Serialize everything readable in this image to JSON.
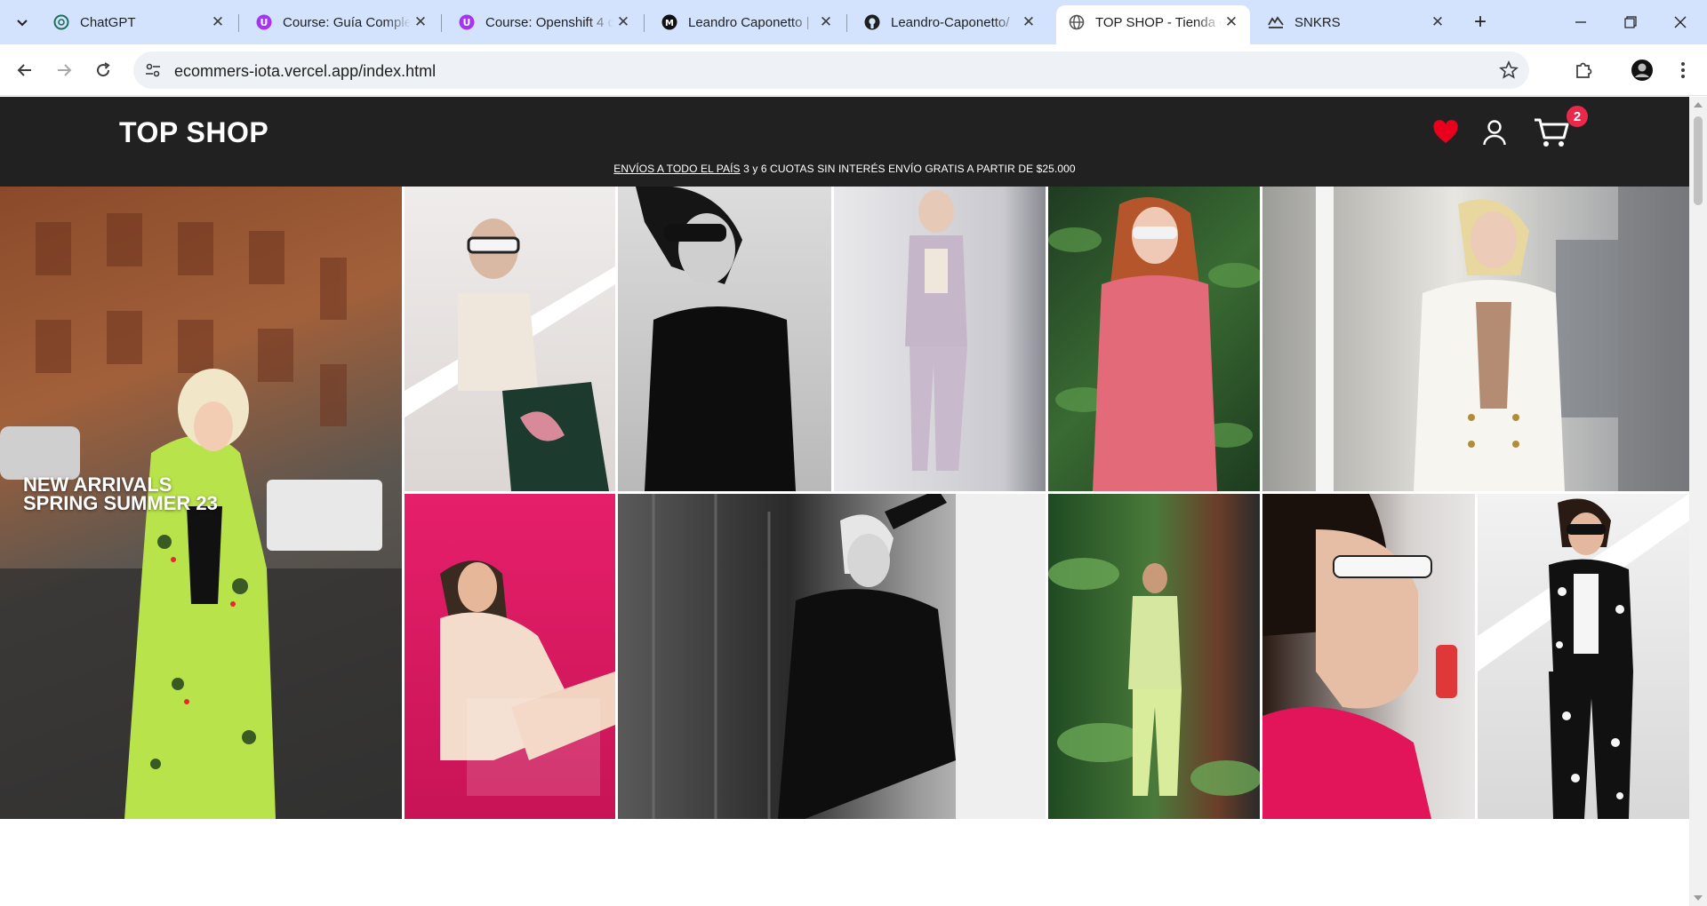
{
  "browser": {
    "tabs": [
      {
        "title": "ChatGPT",
        "icon": "chatgpt-icon"
      },
      {
        "title": "Course: Guía Comple",
        "icon": "course-icon"
      },
      {
        "title": "Course: Openshift 4 c",
        "icon": "course-icon"
      },
      {
        "title": "Leandro Caponetto |",
        "icon": "profile-icon"
      },
      {
        "title": "Leandro-Caponetto/",
        "icon": "github-icon"
      },
      {
        "title": "TOP SHOP - Tienda c",
        "icon": "globe-icon",
        "active": true
      },
      {
        "title": "SNKRS",
        "icon": "snkrs-icon"
      }
    ],
    "url": "ecommers-iota.vercel.app/index.html"
  },
  "site": {
    "logo": "TOP SHOP",
    "cart_count": "2",
    "promo_link": "ENVÍOS A TODO EL PAÍS",
    "promo_text": " 3 y 6 CUOTAS SIN INTERÉS ENVÍO GRATIS A PARTIR DE $25.000",
    "hero_line1": "NEW ARRIVALS",
    "hero_line2": "SPRING SUMMER 23",
    "colors": {
      "header_bg": "#212121",
      "heart": "#e8001c",
      "badge": "#e8294c",
      "tab_strip": "#d3e3fd"
    }
  },
  "gallery": {
    "tiles": [
      {
        "name": "hero-photo-green-suit-street"
      },
      {
        "name": "photo-white-sunglasses-stairs"
      },
      {
        "name": "photo-black-tank-top-bw"
      },
      {
        "name": "photo-lilac-suit"
      },
      {
        "name": "photo-pink-jumpsuit-plants"
      },
      {
        "name": "photo-white-blazer-window"
      },
      {
        "name": "photo-cream-suit-pink-backdrop"
      },
      {
        "name": "photo-black-blazer-street-bw"
      },
      {
        "name": "photo-lime-suit-plants"
      },
      {
        "name": "photo-profile-pink-blazer"
      },
      {
        "name": "photo-print-suit-stairs"
      }
    ]
  }
}
